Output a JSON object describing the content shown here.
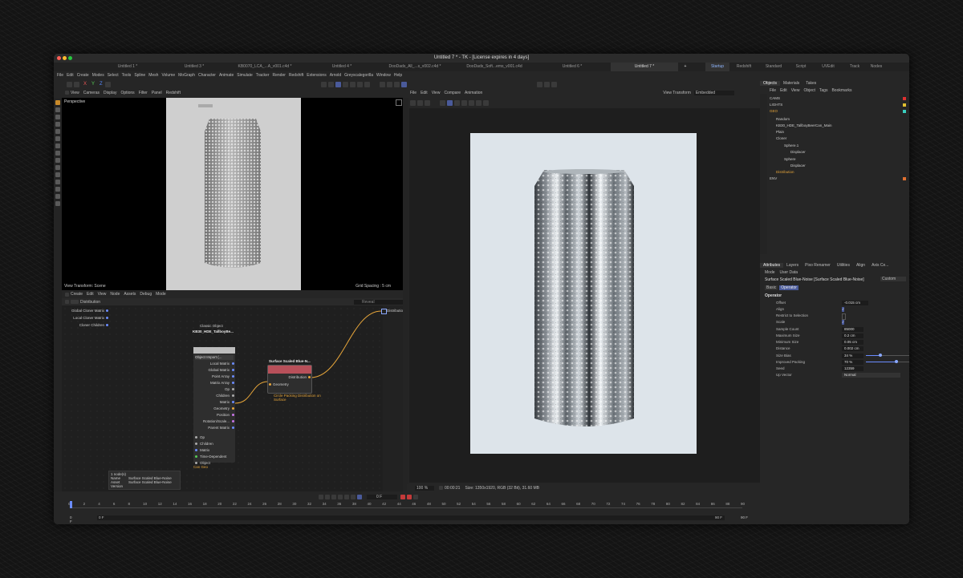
{
  "window_title": "Untitled 7 * - TK - [License expires in 4 days]",
  "doc_tabs": [
    "Untitled 1 *",
    "Untitled 3 *",
    "KB0070_LCA_...A_v001.c4d *",
    "Untitled 4 *",
    "DooDads_All_...s_v002.c4d *",
    "DooDads_Soft...ems_v001.c4d",
    "Untitled 6 *",
    "Untitled 7 *"
  ],
  "layout_tabs": [
    "Startup",
    "Redshift",
    "Standard",
    "Script",
    "UVEdit",
    "Track",
    "Nodes"
  ],
  "menu": [
    "File",
    "Edit",
    "Create",
    "Modes",
    "Select",
    "Tools",
    "Spline",
    "Mesh",
    "Volume",
    "MoGraph",
    "Character",
    "Animate",
    "Simulate",
    "Tracker",
    "Render",
    "Redshift",
    "Extensions",
    "Arnold",
    "Greyscalegorilla",
    "Window",
    "Help"
  ],
  "viewport": {
    "menu": [
      "View",
      "Cameras",
      "Display",
      "Options",
      "Filter",
      "Panel",
      "Redshift"
    ],
    "label": "Perspective",
    "bottom_left": "View Transform: Scene",
    "bottom_right": "Grid Spacing : 5 cm"
  },
  "node_editor": {
    "menu": [
      "Create",
      "Edit",
      "View",
      "Node",
      "Assets",
      "Debug",
      "Mode"
    ],
    "breadcrumb": "Distribution",
    "search_placeholder": "Reveal",
    "inputs": [
      "Global Cloner Matrix",
      "Local Cloner Matrix",
      "Cloner Children"
    ],
    "output": "Distribution",
    "classic_title": "Classic Object",
    "classic_name": "KB30_HDE_TallboyBe...",
    "classic_dropdown": "Object Import (...",
    "classic_ports": [
      "Local Matrix",
      "Global Matrix",
      "Point Array",
      "Matrix Array",
      "Op",
      "Children",
      "Matrix",
      "Geometry",
      "Position",
      "Rotation/Scale...",
      "Parent Matrix"
    ],
    "classic_outputs": [
      "Op",
      "Children",
      "Matrix",
      "Time-Dependent",
      "Object"
    ],
    "classic_footer": "Can Geo",
    "surf_title": "Surface Scaled Blue-N...",
    "surf_out": "Distribution",
    "surf_in": "Geometry",
    "surf_note": "Circle Packing Distribution on Surface",
    "info": {
      "count": "1 node(s)",
      "name_label": "Name",
      "name_value": "Surface Scaled Blue-Noise",
      "asset_label": "Asset",
      "asset_value": "Surface Scaled Blue-Noise",
      "version_label": "Version"
    }
  },
  "render_view": {
    "menu": [
      "File",
      "Edit",
      "View",
      "Compare",
      "Animation"
    ],
    "view_transform_label": "View Transform",
    "view_transform_value": "Embedded",
    "zoom": "100 %",
    "time": "00:00:21",
    "info": "Size: 1350x1920, RGB (32 Bit), 31.60 MB"
  },
  "objects": {
    "tabs": [
      "Objects",
      "Materials",
      "Takes"
    ],
    "menu": [
      "File",
      "Edit",
      "View",
      "Object",
      "Tags",
      "Bookmarks"
    ],
    "items": [
      {
        "name": "CAMS",
        "color": "#ffffff",
        "tag": "#e03030"
      },
      {
        "name": "LIGHTS",
        "color": "#ffffff",
        "tag": "#e0c030"
      },
      {
        "name": "GEO",
        "color": "#e6a53a",
        "tag": "#3ad0c0"
      },
      {
        "name": "Random",
        "color": "#cccccc",
        "tag": "#3ad0c0"
      },
      {
        "name": "KB30_HDE_TallboyBeerCan_Main",
        "color": "#cccccc",
        "tag": "#3ad0c0"
      },
      {
        "name": "Plain",
        "color": "#cccccc",
        "tag": "#3ad0c0"
      },
      {
        "name": "Cloner",
        "color": "#cccccc",
        "tag": "#3ad0c0"
      },
      {
        "name": "Sphere.1",
        "color": "#cccccc",
        "tag": "#3ad0c0"
      },
      {
        "name": "Displacer",
        "color": "#cccccc",
        "tag": "#3ad0c0"
      },
      {
        "name": "Sphere",
        "color": "#cccccc",
        "tag": "#3ad0c0"
      },
      {
        "name": "Displacer",
        "color": "#cccccc",
        "tag": "#3ad0c0"
      },
      {
        "name": "Distribution",
        "color": "#e6a53a",
        "tag": "#3ad0c0"
      },
      {
        "name": "ENV",
        "color": "#cccccc",
        "tag": "#e07030"
      }
    ]
  },
  "attributes": {
    "tabs": [
      "Attributes",
      "Layers",
      "Pixo Renamer",
      "Utilities",
      "Align",
      "Axis Ce..."
    ],
    "menu": [
      "Mode",
      "User Data"
    ],
    "object": "Surface Scaled Blue-Noise [Surface Scaled Blue-Noise]",
    "preset": "Custom",
    "subtabs": [
      "Basic",
      "Operator"
    ],
    "section": "Operator",
    "rows": [
      {
        "label": "Offset",
        "value": "-0.015 cm"
      },
      {
        "label": "Align",
        "value": "✓"
      },
      {
        "label": "Restrict to Selection",
        "value": ""
      },
      {
        "label": "Scale",
        "value": "✓"
      },
      {
        "label": "Sample Count",
        "value": "85000"
      },
      {
        "label": "Maximum Size",
        "value": "0.2 cm"
      },
      {
        "label": "Minimum Size",
        "value": "0.05 cm"
      },
      {
        "label": "Distance",
        "value": "0.002 cm"
      },
      {
        "label": "Size Bias",
        "value": "34 %"
      },
      {
        "label": "Improved Packing",
        "value": "70 %"
      },
      {
        "label": "Seed",
        "value": "12359"
      },
      {
        "label": "Up Vector",
        "value": "Normal"
      }
    ]
  },
  "timeline": {
    "ticks": [
      "0",
      "2",
      "4",
      "6",
      "8",
      "10",
      "12",
      "14",
      "16",
      "18",
      "20",
      "22",
      "24",
      "26",
      "28",
      "30",
      "32",
      "34",
      "36",
      "38",
      "40",
      "42",
      "44",
      "46",
      "48",
      "50",
      "52",
      "54",
      "56",
      "58",
      "60",
      "62",
      "64",
      "66",
      "68",
      "70",
      "72",
      "74",
      "76",
      "78",
      "80",
      "82",
      "84",
      "86",
      "88",
      "90"
    ],
    "start": "0 F",
    "start2": "0 F",
    "current": "0 F",
    "end": "90 F",
    "end2": "90 F"
  }
}
